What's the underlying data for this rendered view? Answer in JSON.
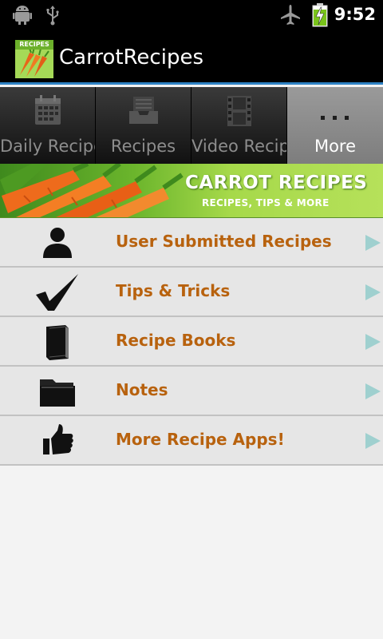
{
  "status_bar": {
    "time": "9:52",
    "icons": [
      "android-icon",
      "usb-icon",
      "airplane-mode-icon",
      "battery-charging-icon"
    ]
  },
  "app": {
    "title": "CarrotRecipes",
    "logo_label": "RECIPES"
  },
  "tabs": [
    {
      "label": "Daily Recipes",
      "icon": "calendar-icon",
      "selected": false
    },
    {
      "label": "Recipes",
      "icon": "inbox-icon",
      "selected": false
    },
    {
      "label": "Video Recipe",
      "icon": "film-icon",
      "selected": false
    },
    {
      "label": "More",
      "icon": "more-dots-icon",
      "selected": true
    }
  ],
  "banner": {
    "title": "CARROT RECIPES",
    "subtitle": "RECIPES, TIPS & MORE"
  },
  "menu": {
    "items": [
      {
        "label": "User Submitted Recipes",
        "icon": "user-icon"
      },
      {
        "label": "Tips & Tricks",
        "icon": "checkmark-icon"
      },
      {
        "label": "Recipe Books",
        "icon": "book-icon"
      },
      {
        "label": "Notes",
        "icon": "folder-icon"
      },
      {
        "label": "More Recipe Apps!",
        "icon": "thumbs-up-icon"
      }
    ]
  },
  "colors": {
    "accent_bar": "#2f82c4",
    "menu_label": "#b8620e",
    "banner_green": "#8fcf3e",
    "arrow": "#9fd0cf"
  }
}
